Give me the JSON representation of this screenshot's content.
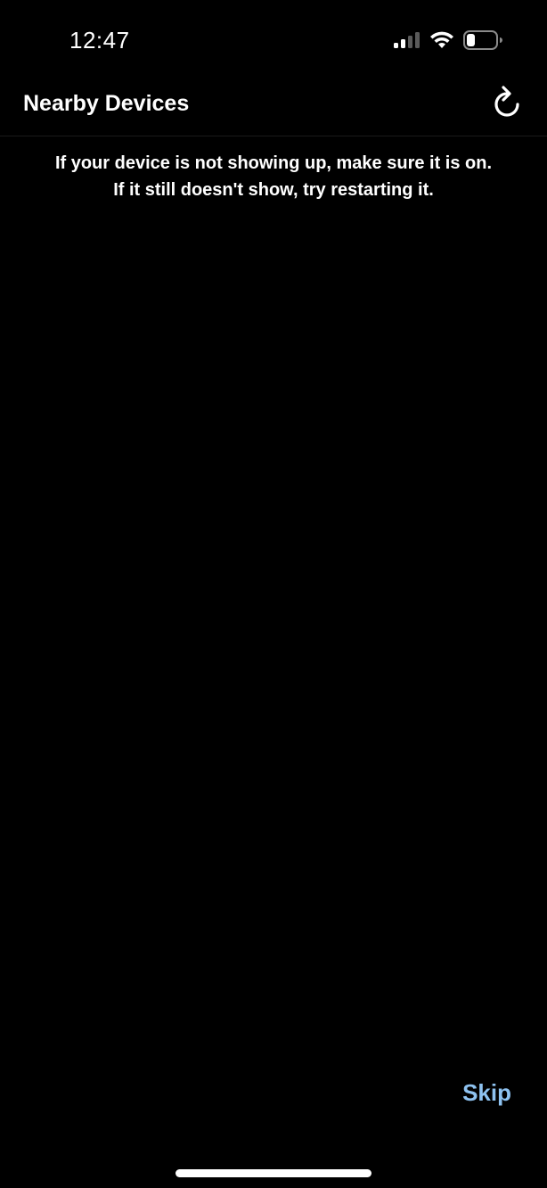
{
  "status_bar": {
    "time": "12:47",
    "signal_icon": "cellular-signal-icon",
    "wifi_icon": "wifi-icon",
    "battery_icon": "battery-icon",
    "battery_level": 0.25
  },
  "header": {
    "title": "Nearby Devices",
    "refresh_icon": "refresh-icon"
  },
  "hint": {
    "line1": "If your device is not showing up, make sure it is on.",
    "line2": "If it still doesn't show, try restarting it."
  },
  "footer": {
    "skip_label": "Skip"
  },
  "colors": {
    "background": "#000000",
    "text": "#ffffff",
    "accent": "#8ec2f0"
  }
}
